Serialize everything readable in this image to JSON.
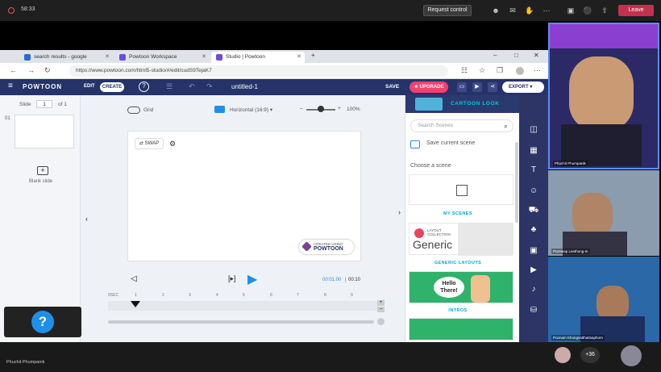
{
  "meeting": {
    "time": "58:33",
    "request_control": "Request control",
    "leave": "Leave",
    "presenter_name": "Phuchit Phumpanik",
    "more_count": "+36"
  },
  "browser": {
    "tabs": [
      {
        "label": "search results - google"
      },
      {
        "label": "Powtoon Workspace"
      },
      {
        "label": "Studio | Powtoon"
      }
    ],
    "url": "https://www.powtoon.com/html5-studio/#/edit/cudS9TejaK7"
  },
  "powtoon": {
    "logo": "POWTOON",
    "edit": "EDIT",
    "create": "CREATE",
    "title": "untitled-1",
    "save": "SAVE",
    "upgrade": "UPGRADE",
    "export": "EXPORT",
    "slide_label": "Slide",
    "slide_num": "1",
    "slide_of": "of 1",
    "slide_index": "01",
    "blank_slide": "Blank slide",
    "grid": "Grid",
    "orientation": "Horizontal (16:9)",
    "zoom": "100%",
    "swap": "SWAP",
    "badge_top": "CREATED USING",
    "badge_main": "POWTOON",
    "time_current": "00:01.00",
    "time_total": "00:10",
    "ticks": [
      "0SEC",
      "1",
      "2",
      "3",
      "4",
      "5",
      "6",
      "7",
      "8",
      "9"
    ]
  },
  "scenes": {
    "header": "CARTOON LOOK",
    "search_placeholder": "Search Scenes",
    "save_current": "Save current scene",
    "choose": "Choose a scene",
    "my_scenes": "MY SCENES",
    "layout_small": "LAYOUT COLLECTION",
    "generic_word": "Generic",
    "generic_layouts": "GENERIC LAYOUTS",
    "hello": "Hello There!",
    "intros": "INTROS"
  },
  "participants": [
    {
      "name": "Phuchit Phumpanik"
    },
    {
      "name": "Pornteap Leethong-In"
    },
    {
      "name": "Poonam Khongsatthattsaphorn"
    }
  ],
  "help_label": "?"
}
